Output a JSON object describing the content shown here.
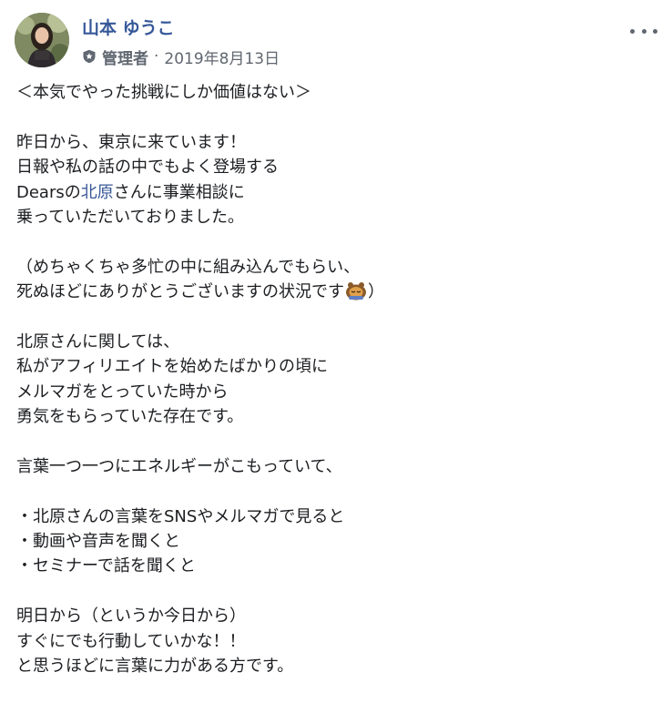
{
  "post": {
    "author_name": "山本 ゆうこ",
    "role": "管理者",
    "separator": "·",
    "date": "2019年8月13日",
    "more_icon": "more-horizontal-icon",
    "admin_icon": "shield-star-icon",
    "lines": [
      "＜本気でやった挑戦にしか価値はない＞",
      "",
      "昨日から、東京に来ています！",
      "日報や私の話の中でもよく登場する",
      {
        "before": "Dearsの",
        "link": "北原",
        "after": "さんに事業相談に"
      },
      "乗っていただいておりました。",
      "",
      "（めちゃくちゃ多忙の中に組み込んでもらい、",
      {
        "before": "死ぬほどにありがとうございますの状況です",
        "emoji": "lion-bowing-emoji",
        "after": "）"
      },
      "",
      "北原さんに関しては、",
      "私がアフィリエイトを始めたばかりの頃に",
      "メルマガをとっていた時から",
      "勇気をもらっていた存在です。",
      "",
      "言葉一つ一つにエネルギーがこもっていて、",
      "",
      "・北原さんの言葉をSNSやメルマガで見ると",
      "・動画や音声を聞くと",
      "・セミナーで話を聞くと",
      "",
      "明日から（というか今日から）",
      "すぐにでも行動していかな！！",
      "と思うほどに言葉に力がある方です。"
    ]
  },
  "colors": {
    "author": "#365899",
    "link": "#385898",
    "meta": "#616770",
    "text": "#1c1e21"
  }
}
